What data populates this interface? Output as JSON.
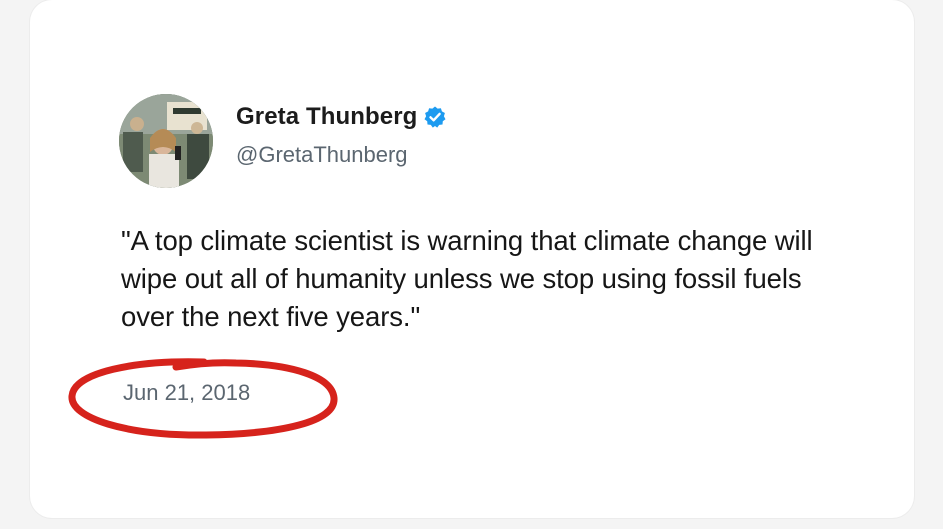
{
  "tweet": {
    "display_name": "Greta Thunberg",
    "handle": "@GretaThunberg",
    "text": "\"A top climate scientist is warning that climate change will wipe out all of humanity unless we stop using fossil fuels over the next five years.\"",
    "date": "Jun 21, 2018"
  },
  "icons": {
    "verified": "verified-badge-icon",
    "avatar": "profile-photo"
  },
  "colors": {
    "verified_blue": "#1d9bf0",
    "highlight_red": "#d6231c",
    "text_primary": "#161616",
    "text_secondary": "#5b6670"
  }
}
